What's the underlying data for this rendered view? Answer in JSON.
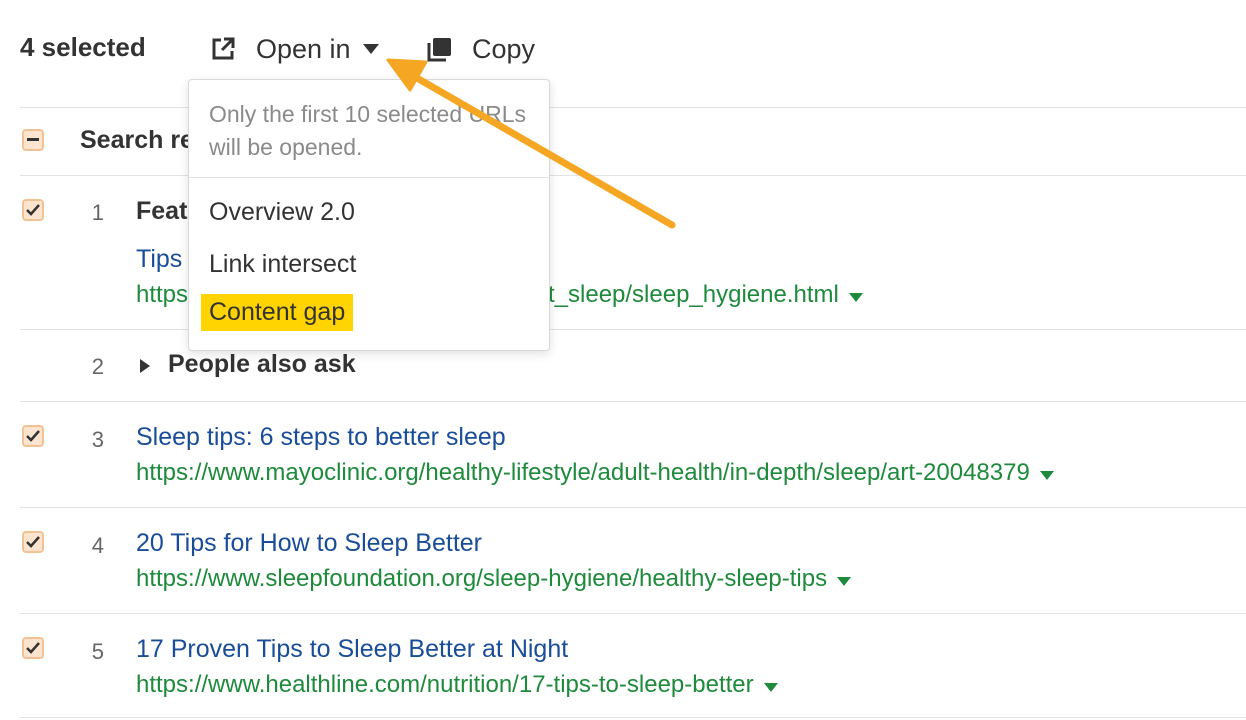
{
  "toolbar": {
    "selected_count": "4 selected",
    "open_in_label": "Open in",
    "copy_label": "Copy"
  },
  "dropdown": {
    "note": "Only the first 10 selected URLs will be opened.",
    "items": [
      {
        "label": "Overview 2.0"
      },
      {
        "label": "Link intersect"
      },
      {
        "label": "Content gap",
        "highlighted": true
      }
    ]
  },
  "results_header": {
    "label": "Search re"
  },
  "rows": [
    {
      "num": "1",
      "title": "Feat",
      "subtitle": "Tips",
      "url_prefix": "https",
      "url_suffix": "t_sleep/sleep_hygiene.html",
      "checked": true
    },
    {
      "num": "2",
      "label": "People also ask",
      "checked": false
    },
    {
      "num": "3",
      "title": "Sleep tips: 6 steps to better sleep",
      "url": "https://www.mayoclinic.org/healthy-lifestyle/adult-health/in-depth/sleep/art-20048379",
      "checked": true
    },
    {
      "num": "4",
      "title": "20 Tips for How to Sleep Better",
      "url": "https://www.sleepfoundation.org/sleep-hygiene/healthy-sleep-tips",
      "checked": true
    },
    {
      "num": "5",
      "title": "17 Proven Tips to Sleep Better at Night",
      "url": "https://www.healthline.com/nutrition/17-tips-to-sleep-better",
      "checked": true
    }
  ],
  "colors": {
    "accent_arrow": "#f5a623",
    "highlight": "#ffd400",
    "link_title": "#1a4d99",
    "link_url": "#1e8a3b",
    "checkbox_fill": "#fde4cf",
    "checkbox_border": "#f3c294"
  },
  "icons": {
    "open_in": "external-link-icon",
    "open_in_caret": "caret-down-icon",
    "copy": "copy-icon",
    "checkbox": "check-icon",
    "select_all": "minus-icon",
    "expand": "triangle-right-icon",
    "url_caret": "caret-down-icon"
  }
}
